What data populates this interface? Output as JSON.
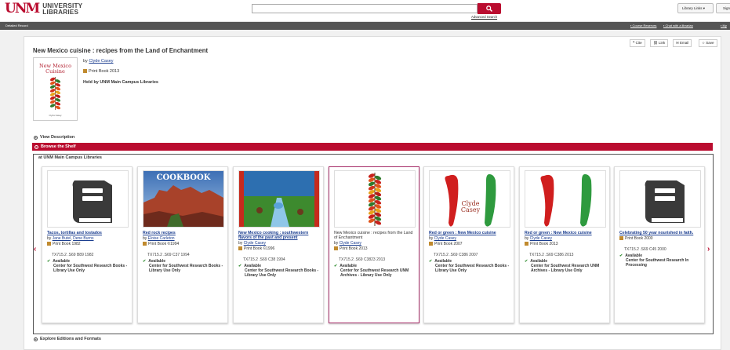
{
  "header": {
    "logo_mark": "UNM",
    "logo_line1": "UNIVERSITY",
    "logo_line2": "LIBRARIES",
    "advanced_search": "Advanced Search",
    "library_links": "Library Links",
    "sign_in": "Sign In"
  },
  "nav_bar": {
    "detailed_record": "Detailed Record",
    "course_reserves": "Course Reserves",
    "chat": "Chat with a librarian",
    "my": "My"
  },
  "actions": {
    "cite": "Cite",
    "link": "Link",
    "email": "Email",
    "save": "Save"
  },
  "record": {
    "title": "New Mexico cuisine : recipes from the Land of Enchantment",
    "by_prefix": "by",
    "author": "Clyde Casey",
    "format": "Print Book 2013",
    "held_by": "Held by UNM Main Campus Libraries",
    "cover_title_line1": "New Mexico",
    "cover_title_line2": "Cuisine",
    "cover_author": "Clyde Casey"
  },
  "sections": {
    "view_description": "View Description",
    "browse_shelf": "Browse the Shelf",
    "location": "at UNM Main Campus Libraries",
    "explore": "Explore Editions and Formats"
  },
  "shelf_items": [
    {
      "title": "Tacos, tortillas and tostados",
      "authors": [
        "Jane Butel",
        "Dene Burns"
      ],
      "format": "Print Book 1982",
      "call_number": "TX715.2 .S69 B89 1982",
      "status": "Available",
      "location": "Center for Southwest Research Books - Library Use Only",
      "image": "book-icon",
      "selected": false,
      "linked": true
    },
    {
      "title": "Red rock recipes",
      "authors": [
        "Eloise Carleton"
      ],
      "format": "Print Book ©1994",
      "call_number": "TX715.2 .S69 C37 1994",
      "status": "Available",
      "location": "Center for Southwest Research Books - Library Use Only",
      "image": "cookbook-cover",
      "cover_text": "COOKBOOK",
      "selected": false,
      "linked": true
    },
    {
      "title": "New Mexico cooking : southwestern flavors of the past and present",
      "authors": [
        "Clyde Casey"
      ],
      "format": "Print Book ©1996",
      "call_number": "TX715.2 .S69 C38 1994",
      "status": "Available",
      "location": "Center for Southwest Research Books - Library Use Only",
      "image": "landscape-cover",
      "selected": false,
      "linked": true
    },
    {
      "title": "New Mexico cuisine : recipes from the Land of Enchantment",
      "authors": [
        "Clyde Casey"
      ],
      "format": "Print Book 2013",
      "call_number": "TX715.2 .S69 C3823 2013",
      "status": "Available",
      "location": "Center for Southwest Research UNM Archives - Library Use Only",
      "image": "ristra-cover",
      "selected": true,
      "linked": false
    },
    {
      "title": "Red or green : New Mexico cuisine",
      "authors": [
        "Clyde Casey"
      ],
      "format": "Print Book 2007",
      "call_number": "TX715.2 .S69 C386 2007",
      "status": "Available",
      "location": "Center for Southwest Research Books - Library Use Only",
      "image": "chiles-cover",
      "cover_text": "Clyde Casey",
      "selected": false,
      "linked": true
    },
    {
      "title": "Red or green : New Mexico cuisine",
      "authors": [
        "Clyde Casey"
      ],
      "format": "Print Book 2013",
      "call_number": "TX715.2 .S69 C386 2013",
      "status": "Available",
      "location": "Center for Southwest Research UNM Archives - Library Use Only",
      "image": "chiles-cover",
      "selected": false,
      "linked": true
    },
    {
      "title": "Celebrating 50 year nourished in faith.",
      "authors": [],
      "format": "Print Book 2000",
      "call_number": "TX715.2 .S69 C45 2000",
      "status": "Available",
      "location": "Center for Southwest Research In Processing",
      "image": "book-icon",
      "selected": false,
      "linked": true
    }
  ],
  "colors": {
    "accent": "#ba0c2f",
    "selected_border": "#a8306b",
    "available": "#2b8a2b",
    "link": "#1a3d8f"
  }
}
